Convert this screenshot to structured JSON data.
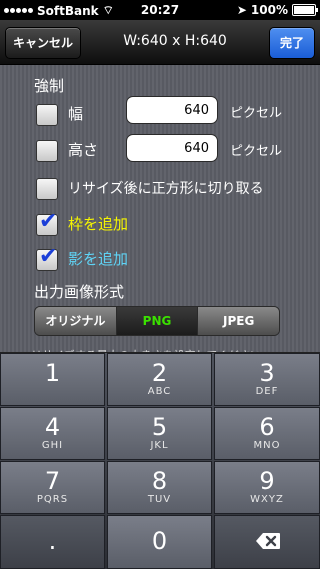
{
  "status": {
    "carrier": "SoftBank",
    "time": "20:27",
    "battery": "100%",
    "battery_level": 1.0
  },
  "nav": {
    "cancel_label": "キャンセル",
    "title": "W:640 x H:640",
    "done_label": "完了"
  },
  "settings": {
    "section_force": "強制",
    "width_label": "幅",
    "width_value": "640",
    "height_label": "高さ",
    "height_value": "640",
    "unit": "ピクセル",
    "crop_label": "リサイズ後に正方形に切り取る",
    "frame_label": "枠を追加",
    "shadow_label": "影を追加",
    "format_section": "出力画像形式",
    "formats": [
      "オリジナル",
      "PNG",
      "JPEG"
    ],
    "selected_format": "PNG",
    "hint": "・リサイズする最大の大きさを設定してください"
  },
  "keypad": {
    "keys": [
      {
        "num": "1",
        "letters": ""
      },
      {
        "num": "2",
        "letters": "ABC"
      },
      {
        "num": "3",
        "letters": "DEF"
      },
      {
        "num": "4",
        "letters": "GHI"
      },
      {
        "num": "5",
        "letters": "JKL"
      },
      {
        "num": "6",
        "letters": "MNO"
      },
      {
        "num": "7",
        "letters": "PQRS"
      },
      {
        "num": "8",
        "letters": "TUV"
      },
      {
        "num": "9",
        "letters": "WXYZ"
      },
      {
        "num": ".",
        "letters": ""
      },
      {
        "num": "0",
        "letters": ""
      }
    ]
  },
  "colors": {
    "accent_blue": "#1a5dd6",
    "png_green": "#3be000",
    "frame_yellow": "#f5f500",
    "shadow_cyan": "#5fd3f5",
    "check_blue": "#1b3fd8"
  }
}
